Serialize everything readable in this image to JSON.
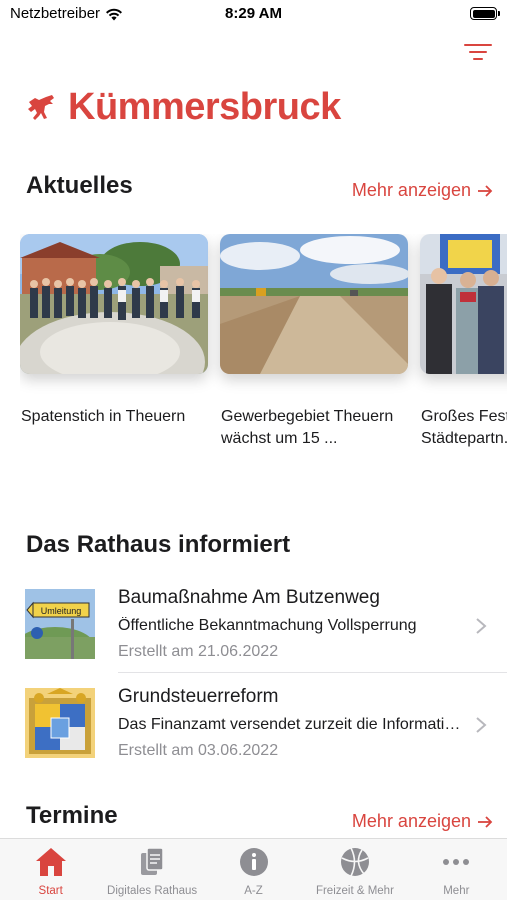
{
  "status_bar": {
    "carrier": "Netzbetreiber",
    "time": "8:29 AM",
    "icons": [
      "wifi-icon",
      "battery-icon"
    ]
  },
  "header": {
    "app_title": "Kümmersbruck",
    "logo": "horse-logo",
    "filter_icon": "filter-icon"
  },
  "colors": {
    "accent": "#d9453f",
    "text": "#1c1c1e",
    "secondary": "#8e8e93"
  },
  "aktuelles": {
    "title": "Aktuelles",
    "more_label": "Mehr anzeigen",
    "more_icon": "arrow-right-icon",
    "cards": [
      {
        "title": "Spatenstich in Theuern"
      },
      {
        "title": "Gewerbegebiet Theuern wächst um 15 ..."
      },
      {
        "title": "Großes Fest Städtepartn..."
      }
    ]
  },
  "rathaus": {
    "title": "Das Rathaus informiert",
    "items": [
      {
        "title": "Baumaßnahme Am Butzenweg",
        "subtitle": "Öffentliche Bekanntmachung  Vollsperrung",
        "date": "Erstellt am 21.06.2022",
        "thumb_text": "Umleitung"
      },
      {
        "title": "Grundsteuerreform",
        "subtitle": "Das Finanzamt versendet zurzeit die Informationen",
        "date": "Erstellt am 03.06.2022"
      }
    ]
  },
  "termine": {
    "title": "Termine",
    "more_label": "Mehr anzeigen"
  },
  "tab_bar": {
    "tabs": [
      {
        "label": "Start",
        "icon": "home-icon",
        "active": true
      },
      {
        "label": "Digitales Rathaus",
        "icon": "documents-icon",
        "active": false
      },
      {
        "label": "A-Z",
        "icon": "info-icon",
        "active": false
      },
      {
        "label": "Freizeit & Mehr",
        "icon": "ball-icon",
        "active": false
      },
      {
        "label": "Mehr",
        "icon": "more-icon",
        "active": false
      }
    ]
  }
}
